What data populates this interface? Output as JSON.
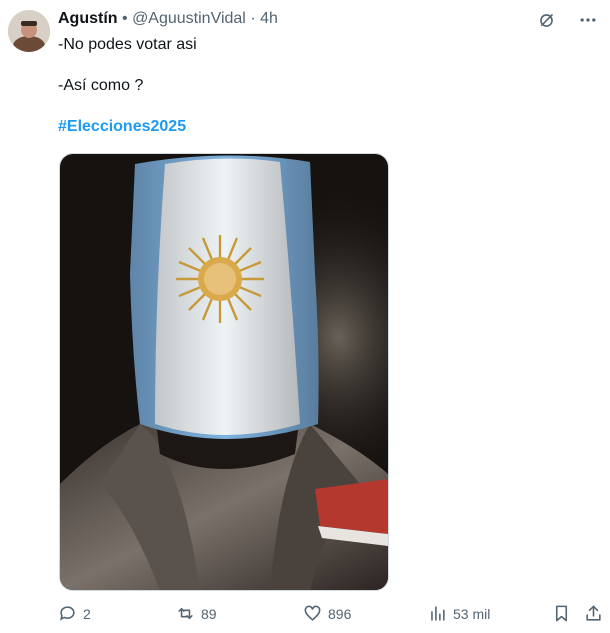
{
  "tweet": {
    "author_name": "Agustín",
    "separator": "•",
    "handle": "@AguustinVidal",
    "dot": "·",
    "time": "4h",
    "text_line_1": "-No podes votar asi",
    "text_line_2": "-Así como ?",
    "hashtag": "#Elecciones2025"
  },
  "actions": {
    "replies": "2",
    "retweets": "89",
    "likes": "896",
    "views": "53 mil"
  },
  "icons": {
    "top": [
      "grok-icon",
      "more-icon"
    ],
    "bottom": [
      "reply-icon",
      "retweet-icon",
      "like-icon",
      "views-icon",
      "bookmark-icon",
      "share-icon"
    ]
  },
  "colors": {
    "accent": "#1d9bf0",
    "muted": "#536471",
    "text": "#0f1419"
  }
}
